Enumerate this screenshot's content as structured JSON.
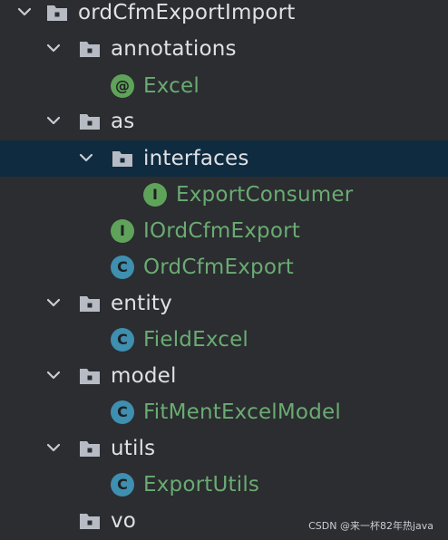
{
  "tree": [
    {
      "name": "ordCfmExportImport",
      "kind": "folder",
      "expanded": true,
      "selected": false
    },
    {
      "name": "annotations",
      "kind": "folder",
      "expanded": true,
      "selected": false
    },
    {
      "name": "Excel",
      "kind": "annotation",
      "icon": "@",
      "selected": false
    },
    {
      "name": "as",
      "kind": "folder",
      "expanded": true,
      "selected": false
    },
    {
      "name": "interfaces",
      "kind": "folder",
      "expanded": true,
      "selected": true
    },
    {
      "name": "ExportConsumer",
      "kind": "interface",
      "icon": "I",
      "selected": false
    },
    {
      "name": "IOrdCfmExport",
      "kind": "interface",
      "icon": "I",
      "selected": false
    },
    {
      "name": "OrdCfmExport",
      "kind": "class",
      "icon": "C",
      "selected": false
    },
    {
      "name": "entity",
      "kind": "folder",
      "expanded": true,
      "selected": false
    },
    {
      "name": "FieldExcel",
      "kind": "class",
      "icon": "C",
      "selected": false
    },
    {
      "name": "model",
      "kind": "folder",
      "expanded": true,
      "selected": false
    },
    {
      "name": "FitMentExcelModel",
      "kind": "class",
      "icon": "C",
      "selected": false
    },
    {
      "name": "utils",
      "kind": "folder",
      "expanded": true,
      "selected": false
    },
    {
      "name": "ExportUtils",
      "kind": "class",
      "icon": "C",
      "selected": false
    },
    {
      "name": "vo",
      "kind": "folder",
      "expanded": false,
      "selected": false
    }
  ],
  "watermark": "CSDN @来一杯82年热java",
  "colors": {
    "background": "#2b2d30",
    "selection": "#0f2b3f",
    "folder_text": "#dfe1e5",
    "class_text": "#6aab73",
    "class_badge": "#3e8fb0",
    "interface_badge": "#5fa35a"
  }
}
